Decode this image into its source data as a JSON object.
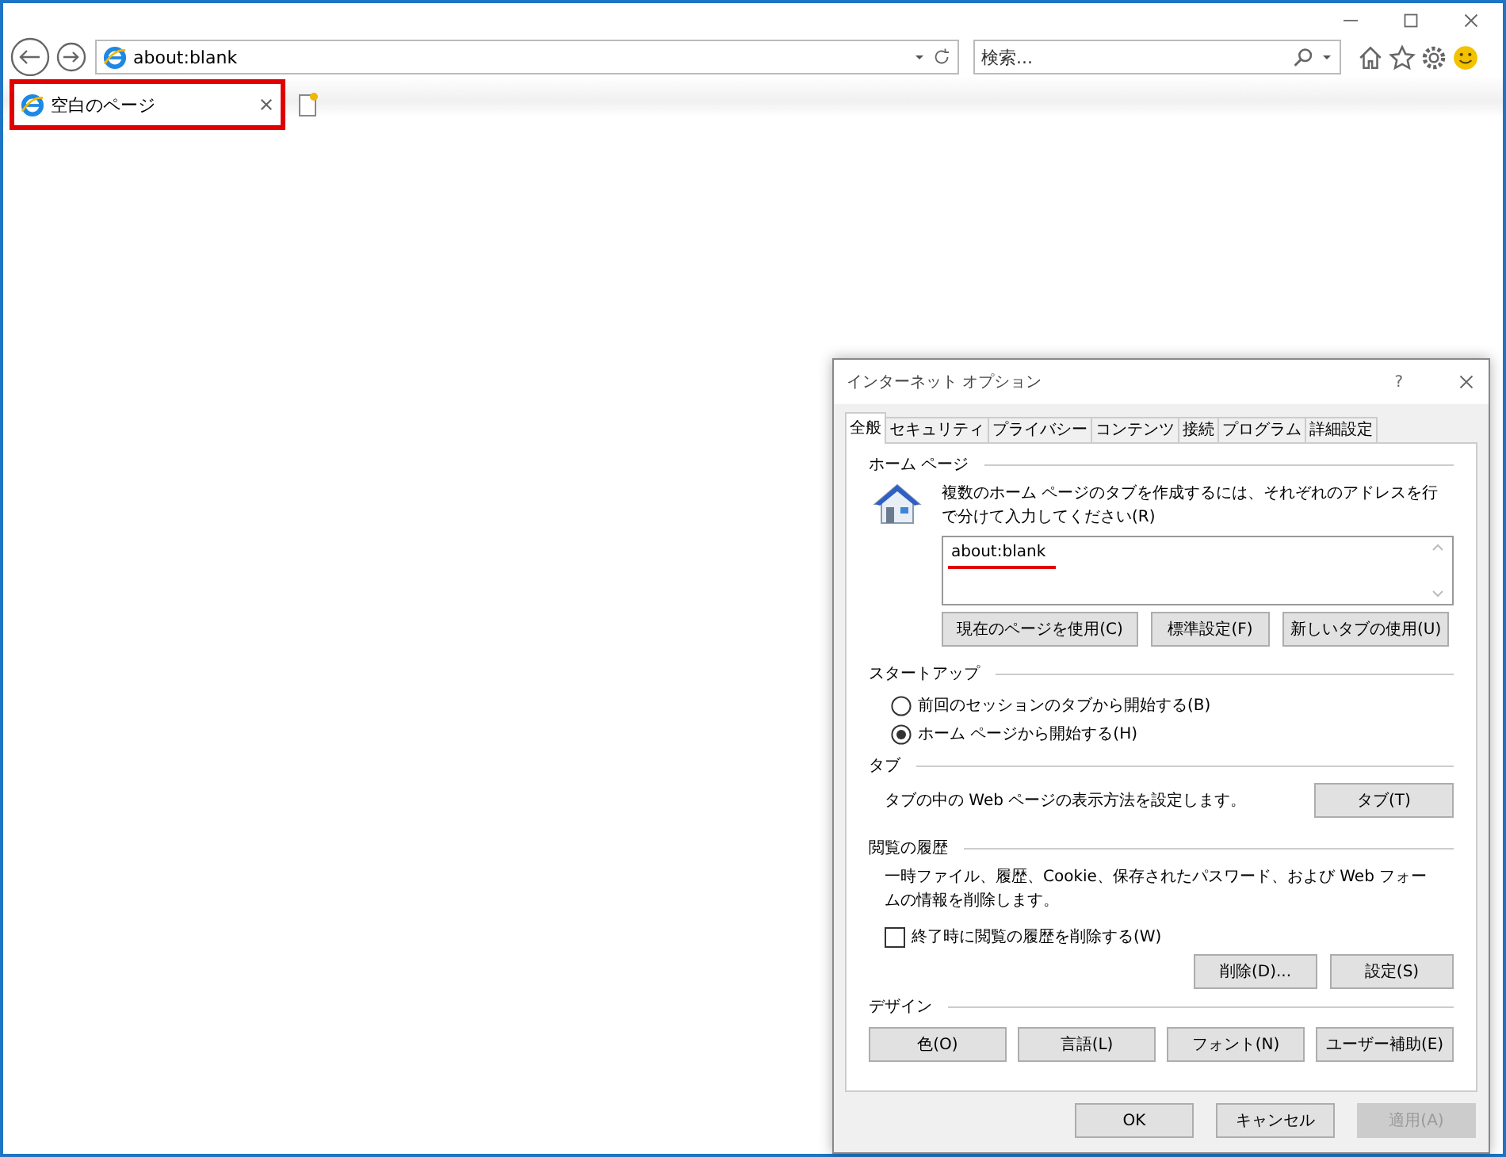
{
  "browser": {
    "address": "about:blank",
    "search": {
      "placeholder": "検索..."
    },
    "tabs": [
      {
        "title": "空白のページ",
        "highlighted": true
      }
    ]
  },
  "dialog": {
    "title": "インターネット オプション",
    "help": "?",
    "tabs": [
      {
        "label": "全般",
        "selected": true
      },
      {
        "label": "セキュリティ",
        "selected": false
      },
      {
        "label": "プライバシー",
        "selected": false
      },
      {
        "label": "コンテンツ",
        "selected": false
      },
      {
        "label": "接続",
        "selected": false
      },
      {
        "label": "プログラム",
        "selected": false
      },
      {
        "label": "詳細設定",
        "selected": false
      }
    ],
    "homepage": {
      "heading": "ホーム ページ",
      "instruction": "複数のホーム ページのタブを作成するには、それぞれのアドレスを行で分けて入力してください(R)",
      "value": "about:blank",
      "underlined": true,
      "buttons": [
        "現在のページを使用(C)",
        "標準設定(F)",
        "新しいタブの使用(U)"
      ]
    },
    "startup": {
      "heading": "スタートアップ",
      "options": [
        {
          "label": "前回のセッションのタブから開始する(B)",
          "selected": false
        },
        {
          "label": "ホーム ページから開始する(H)",
          "selected": true
        }
      ]
    },
    "tab_settings": {
      "heading": "タブ",
      "description": "タブの中の Web ページの表示方法を設定します。",
      "button": "タブ(T)"
    },
    "history": {
      "heading": "閲覧の履歴",
      "description": "一時ファイル、履歴、Cookie、保存されたパスワード、および Web フォームの情報を削除します。",
      "delete_on_exit": {
        "label": "終了時に閲覧の履歴を削除する(W)",
        "checked": false
      },
      "buttons": [
        "削除(D)...",
        "設定(S)"
      ]
    },
    "design": {
      "heading": "デザイン",
      "buttons": [
        "色(O)",
        "言語(L)",
        "フォント(N)",
        "ユーザー補助(E)"
      ]
    },
    "footer": [
      {
        "label": "OK",
        "disabled": false
      },
      {
        "label": "キャンセル",
        "disabled": false
      },
      {
        "label": "適用(A)",
        "disabled": true
      }
    ]
  }
}
